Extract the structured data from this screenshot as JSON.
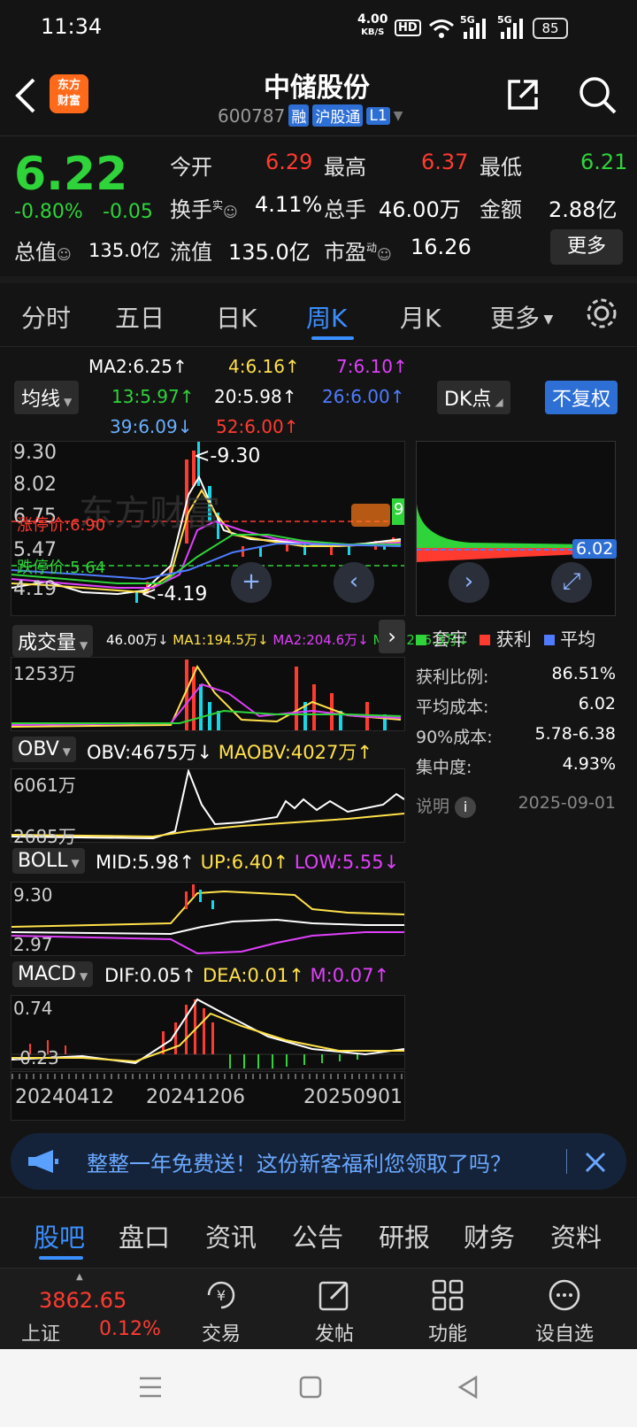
{
  "status": {
    "time": "11:34",
    "net_speed": "4.00",
    "net_unit": "KB/S",
    "hd": "HD",
    "sig1": "5G",
    "sig2": "5G",
    "battery": "85"
  },
  "header": {
    "logo_line1": "东方",
    "logo_line2": "财富",
    "stock_name": "中储股份",
    "stock_code": "600787",
    "badge_rong": "融",
    "badge_hgt": "沪股通",
    "badge_l1": "L1"
  },
  "quote": {
    "price": "6.22",
    "change_pct": "-0.80%",
    "change": "-0.05",
    "open_label": "今开",
    "open": "6.29",
    "high_label": "最高",
    "high": "6.37",
    "low_label": "最低",
    "low": "6.21",
    "turnover_label": "换手",
    "turnover_sup": "实",
    "turnover": "4.11%",
    "volume_label": "总手",
    "volume": "46.00万",
    "amount_label": "金额",
    "amount": "2.88亿",
    "mktcap_label": "总值",
    "mktcap": "135.0亿",
    "float_label": "流值",
    "float": "135.0亿",
    "pe_label": "市盈",
    "pe_sup": "动",
    "pe": "16.26",
    "more": "更多"
  },
  "tabs": [
    "分时",
    "五日",
    "日K",
    "周K",
    "月K",
    "更多"
  ],
  "ma": {
    "ma_button": "均线",
    "ma2": "MA2:6.25",
    "ma4": "4:6.16",
    "ma7": "7:6.10",
    "ma13": "13:5.97",
    "ma20": "20:5.98",
    "ma26": "26:6.00",
    "ma39": "39:6.09",
    "ma52": "52:6.00",
    "dk": "DK点",
    "fq": "不复权"
  },
  "kline": {
    "y_top": "9.30",
    "y2": "8.02",
    "y3": "6.75",
    "y4": "5.47",
    "y_bottom": "4.19",
    "max_label": "<-9.30",
    "min_label": "<-4.19",
    "limit_up": "涨停价:6.90",
    "limit_down": "跌停价:5.64",
    "watermark": "东方财富",
    "side_val": "9"
  },
  "volume": {
    "label": "成交量",
    "vol": "46.00万",
    "ma1": "MA1:194.5万",
    "ma2": "MA2:204.6万",
    "ma3": "MA3:276.3万",
    "y_top": "1253万"
  },
  "obv": {
    "label": "OBV",
    "obv": "OBV:4675万",
    "maobv": "MAOBV:4027万",
    "y_top": "6061万",
    "y_bottom": "2685万"
  },
  "boll": {
    "label": "BOLL",
    "mid": "MID:5.98",
    "up": "UP:6.40",
    "low": "LOW:5.55",
    "y_top": "9.30",
    "y_bottom": "2.97"
  },
  "macd": {
    "label": "MACD",
    "dif": "DIF:0.05",
    "dea": "DEA:0.01",
    "m": "M:0.07",
    "y_top": "0.74",
    "y_bottom": "-0.23"
  },
  "dates": [
    "20240412",
    "20241206",
    "20250901"
  ],
  "chip": {
    "avg_price": "6.02",
    "legend_trapped": "套牢",
    "legend_profit": "获利",
    "legend_avg": "平均",
    "rows": [
      {
        "label": "获利比例:",
        "value": "86.51%"
      },
      {
        "label": "平均成本:",
        "value": "6.02"
      },
      {
        "label": "90%成本:",
        "value": "5.78-6.38"
      },
      {
        "label": "集中度:",
        "value": "4.93%"
      }
    ],
    "explain": "说明",
    "date": "2025-09-01"
  },
  "banner": {
    "text": "整整一年免费送！这份新客福利您领取了吗？"
  },
  "bottom_tabs": [
    "股吧",
    "盘口",
    "资讯",
    "公告",
    "研报",
    "财务",
    "资料"
  ],
  "toolbar": {
    "index_value": "3862.65",
    "index_name": "上证",
    "index_pct": "0.12%",
    "trade": "交易",
    "post": "发帖",
    "func": "功能",
    "watch": "设自选"
  }
}
